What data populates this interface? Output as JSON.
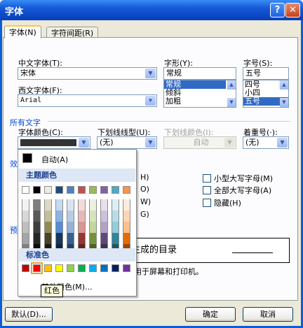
{
  "window": {
    "title": "字体",
    "help_glyph": "?",
    "close_glyph": "✕"
  },
  "tabs": [
    {
      "label": "字体(N)"
    },
    {
      "label": "字符间距(R)"
    }
  ],
  "chinese_font": {
    "label": "中文字体(T):",
    "value": "宋体"
  },
  "western_font": {
    "label": "西文字体(F):",
    "value": "Arial"
  },
  "font_style": {
    "label": "字形(Y):",
    "value": "常规",
    "options": [
      "常规",
      "倾斜",
      "加粗"
    ]
  },
  "font_size": {
    "label": "字号(S):",
    "value": "五号",
    "options": [
      "四号",
      "小四",
      "五号"
    ]
  },
  "all_text": {
    "group_label": "所有文字",
    "font_color": {
      "label": "字体颜色(C):"
    },
    "underline": {
      "label": "下划线线型(U):",
      "value": "(无)"
    },
    "underline_color": {
      "label": "下划线颜色(I):",
      "value": "自动"
    },
    "emphasis": {
      "label": "着重号(·):",
      "value": "(无)"
    }
  },
  "effects": {
    "group_label": "效",
    "small_caps": "小型大写字母(M)",
    "all_caps": "全部大写字母(A)",
    "hidden": "隐藏(H)",
    "left_keys": [
      "H)",
      "O)",
      "W)",
      "G)"
    ]
  },
  "preview": {
    "group_label": "预",
    "text": "生成的目录",
    "note": "适用于屏幕和打印机。"
  },
  "buttons": {
    "default": "默认(D)...",
    "ok": "确定",
    "cancel": "取消"
  },
  "color_popup": {
    "auto_label": "自动(A)",
    "theme_header": "主题颜色",
    "standard_header": "标准色",
    "more_label": "其他颜色(M)...",
    "theme_colors": [
      "#ffffff",
      "#000000",
      "#eeece1",
      "#1f497d",
      "#4f81bd",
      "#c0504d",
      "#9bbb59",
      "#8064a2",
      "#4bacc6",
      "#f79646"
    ],
    "theme_shades": [
      [
        "#f2f2f2",
        "#7f7f7f",
        "#ddd9c3",
        "#c6d9f0",
        "#dbe5f1",
        "#f2dcdb",
        "#ebf1dd",
        "#e5e0ec",
        "#dbeef3",
        "#fdeada"
      ],
      [
        "#d8d8d8",
        "#595959",
        "#c4bd97",
        "#8db3e2",
        "#b8cce4",
        "#e5b9b7",
        "#d7e3bc",
        "#ccc1d9",
        "#b7dde8",
        "#fbd5b5"
      ],
      [
        "#bfbfbf",
        "#3f3f3f",
        "#938953",
        "#548dd4",
        "#95b3d7",
        "#d99694",
        "#c3d69b",
        "#b2a2c7",
        "#92cddc",
        "#fac08f"
      ],
      [
        "#a5a5a5",
        "#262626",
        "#494429",
        "#17365d",
        "#366092",
        "#953734",
        "#76923c",
        "#5f497a",
        "#31859b",
        "#e36c09"
      ],
      [
        "#7f7f7f",
        "#0c0c0c",
        "#1d1b10",
        "#0f243e",
        "#244061",
        "#632423",
        "#4f6128",
        "#3f3151",
        "#205867",
        "#974806"
      ]
    ],
    "standard_colors": [
      "#c00000",
      "#ff0000",
      "#ffc000",
      "#ffff00",
      "#92d050",
      "#00b050",
      "#00b0f0",
      "#0070c0",
      "#002060",
      "#7030a0"
    ],
    "tooltip": "红色"
  }
}
